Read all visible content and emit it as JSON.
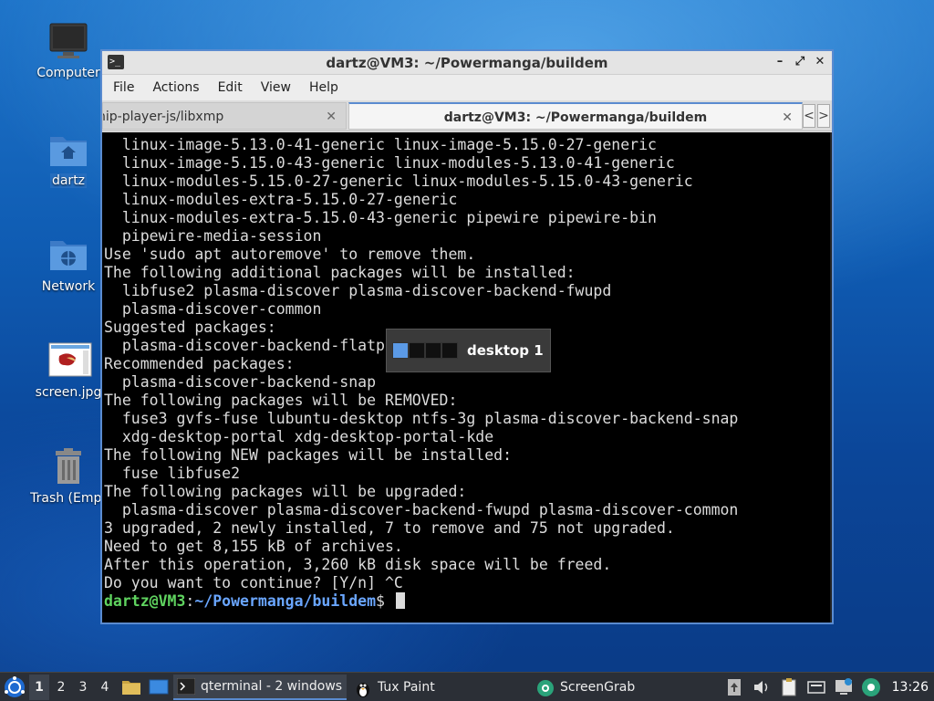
{
  "desktop": {
    "icons": [
      {
        "label": "Computer"
      },
      {
        "label": "dartz"
      },
      {
        "label": "Network"
      },
      {
        "label": "screen.jpg"
      },
      {
        "label": "Trash (Empt"
      }
    ]
  },
  "window": {
    "title": "dartz@VM3: ~/Powermanga/buildem",
    "controls": {
      "minimize": "–",
      "maximize": "⤢",
      "close": "✕"
    },
    "menu": [
      "File",
      "Actions",
      "Edit",
      "View",
      "Help"
    ],
    "tabs": [
      {
        "label": "nip-player-js/libxmp",
        "close": "✕"
      },
      {
        "label": "dartz@VM3: ~/Powermanga/buildem",
        "close": "✕"
      }
    ],
    "tab_nav": {
      "prev": "<",
      "next": ">"
    }
  },
  "terminal": {
    "lines": [
      "  linux-image-5.13.0-41-generic linux-image-5.15.0-27-generic",
      "  linux-image-5.15.0-43-generic linux-modules-5.13.0-41-generic",
      "  linux-modules-5.15.0-27-generic linux-modules-5.15.0-43-generic",
      "  linux-modules-extra-5.15.0-27-generic",
      "  linux-modules-extra-5.15.0-43-generic pipewire pipewire-bin",
      "  pipewire-media-session",
      "Use 'sudo apt autoremove' to remove them.",
      "The following additional packages will be installed:",
      "  libfuse2 plasma-discover plasma-discover-backend-fwupd",
      "  plasma-discover-common",
      "Suggested packages:",
      "  plasma-discover-backend-flatp",
      "Recommended packages:",
      "  plasma-discover-backend-snap",
      "The following packages will be REMOVED:",
      "  fuse3 gvfs-fuse lubuntu-desktop ntfs-3g plasma-discover-backend-snap",
      "  xdg-desktop-portal xdg-desktop-portal-kde",
      "The following NEW packages will be installed:",
      "  fuse libfuse2",
      "The following packages will be upgraded:",
      "  plasma-discover plasma-discover-backend-fwupd plasma-discover-common",
      "3 upgraded, 2 newly installed, 7 to remove and 75 not upgraded.",
      "Need to get 8,155 kB of archives.",
      "After this operation, 3,260 kB disk space will be freed.",
      "Do you want to continue? [Y/n] ^C"
    ],
    "prompt": {
      "user": "dartz@VM3",
      "sep": ":",
      "path": "~/Powermanga/buildem",
      "symbol": "$ "
    }
  },
  "desktop_switcher": {
    "label": "desktop 1",
    "count": 4,
    "active_index": 0
  },
  "taskbar": {
    "workspaces": [
      "1",
      "2",
      "3",
      "4"
    ],
    "active_workspace": "1",
    "tasks": [
      {
        "label": "qterminal - 2 windows",
        "icon": "terminal-icon"
      },
      {
        "label": "Tux Paint",
        "icon": "tux-paint-icon"
      },
      {
        "label": "ScreenGrab",
        "icon": "screengrab-icon"
      }
    ],
    "clock": "13:26"
  },
  "colors": {
    "accent": "#5a8bd0",
    "prompt_user": "#5fd35f",
    "prompt_path": "#6aa6ff",
    "terminal_bg": "#000000",
    "taskbar_bg": "#2b2f36"
  }
}
